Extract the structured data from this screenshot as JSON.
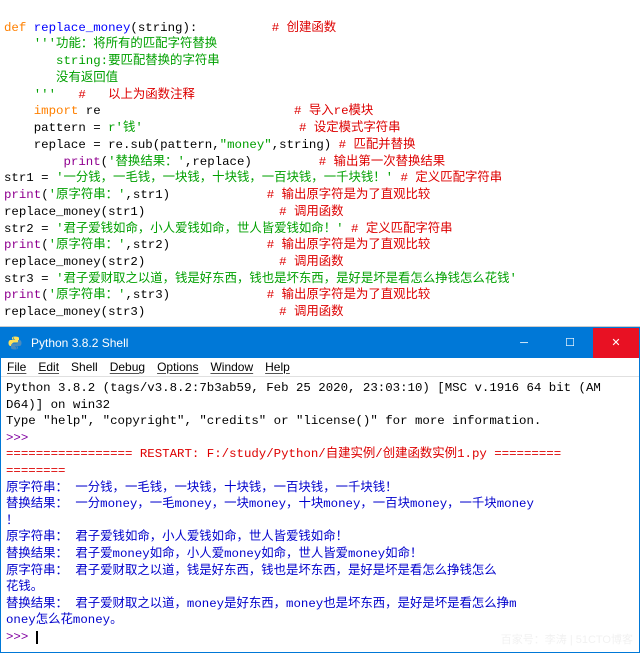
{
  "editor": {
    "l1a": "def",
    "l1b": " replace_money",
    "l1c": "(string):",
    "l1d": "          # 创建函数",
    "l2": "    '''功能：将所有的匹配字符替换",
    "l3": "       string:要匹配替换的字符串",
    "l4": "       没有返回值",
    "l5a": "    '''",
    "l5b": "   #   以上为函数注释",
    "l6a": "    import",
    "l6b": " re",
    "l6c": "                          # 导入re模块",
    "l7a": "    pattern = ",
    "l7b": "r'钱'",
    "l7c": "                     # 设定模式字符串",
    "l8a": "    replace = re.sub(pattern,",
    "l8b": "\"money\"",
    "l8c": ",string)",
    "l8d": " # 匹配并替换",
    "l9a": "    print",
    "l9b": "(",
    "l9c": "'替换结果：'",
    "l9d": ",replace)",
    "l9e": "         # 输出第一次替换结果",
    "l10a": "str1 = ",
    "l10b": "'一分钱，一毛钱，一块钱，十块钱，一百块钱，一千块钱！'",
    "l10c": " # 定义匹配字符串",
    "l11a": "print",
    "l11b": "(",
    "l11c": "'原字符串：'",
    "l11d": ",str1)",
    "l11e": "             # 输出原字符是为了直观比较",
    "l12a": "replace_money(str1)",
    "l12b": "                  # 调用函数",
    "l13a": "str2 = ",
    "l13b": "'君子爱钱如命，小人爱钱如命，世人皆爱钱如命！'",
    "l13c": " # 定义匹配字符串",
    "l14a": "print",
    "l14b": "(",
    "l14c": "'原字符串：'",
    "l14d": ",str2)",
    "l14e": "             # 输出原字符是为了直观比较",
    "l15a": "replace_money(str2)",
    "l15b": "                  # 调用函数",
    "l16a": "str3 = ",
    "l16b": "'君子爱财取之以道，钱是好东西，钱也是坏东西，是好是坏是看怎么挣钱怎么花钱'",
    "l17a": "print",
    "l17b": "(",
    "l17c": "'原字符串：'",
    "l17d": ",str3)",
    "l17e": "             # 输出原字符是为了直观比较",
    "l18a": "replace_money(str3)",
    "l18b": "                  # 调用函数"
  },
  "shell": {
    "title": "Python 3.8.2 Shell",
    "menu": {
      "file": "File",
      "edit": "Edit",
      "shell": "Shell",
      "debug": "Debug",
      "options": "Options",
      "window": "Window",
      "help": "Help"
    },
    "banner1": "Python 3.8.2 (tags/v3.8.2:7b3ab59, Feb 25 2020, 23:03:10) [MSC v.1916 64 bit (AM",
    "banner2": "D64)] on win32",
    "banner3": "Type \"help\", \"copyright\", \"credits\" or \"license()\" for more information.",
    "prompt": ">>> ",
    "restart": "================= RESTART: F:/study/Python/自建实例/创建函数实例1.py =========",
    "eqline": "========",
    "o1": "原字符串： 一分钱，一毛钱，一块钱，十块钱，一百块钱，一千块钱！",
    "o2": "替换结果： 一分money，一毛money，一块money，十块money，一百块money，一千块money",
    "o2b": "！",
    "o3": "原字符串： 君子爱钱如命，小人爱钱如命，世人皆爱钱如命！",
    "o4": "替换结果： 君子爱money如命，小人爱money如命，世人皆爱money如命！",
    "o5": "原字符串： 君子爱财取之以道，钱是好东西，钱也是坏东西，是好是坏是看怎么挣钱怎么",
    "o5b": "花钱。",
    "o6": "替换结果： 君子爱财取之以道，money是好东西，money也是坏东西，是好是坏是看怎么挣m",
    "o6b": "oney怎么花money。"
  },
  "watermark": "百家号：李涛 | 51CTO博客"
}
